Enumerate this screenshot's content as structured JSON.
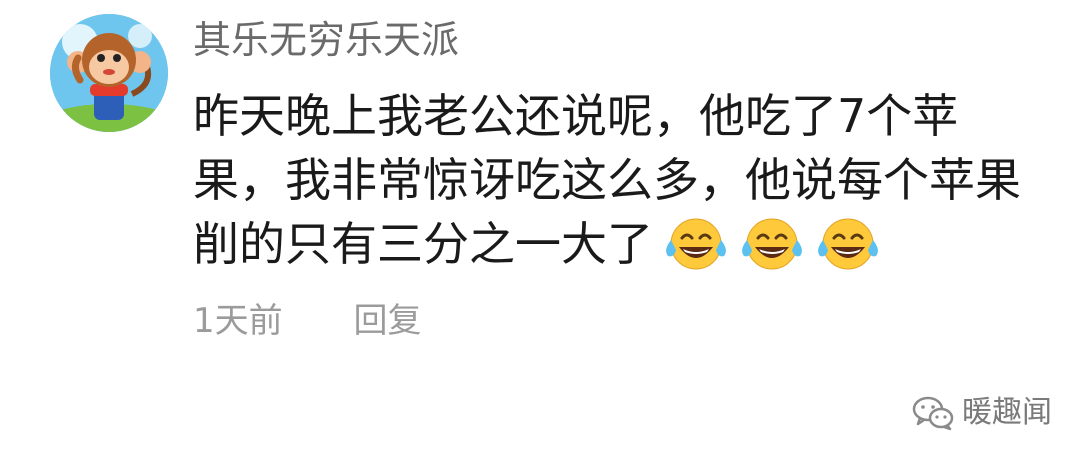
{
  "comment": {
    "username": "其乐无穷乐天派",
    "lines": [
      "昨天晚上我老公还说呢，他吃了7个苹",
      "果，我非常惊讶吃这么多，他说每个苹果",
      "削的只有三分之一大了"
    ],
    "emoji": [
      "tears-of-joy-icon",
      "tears-of-joy-icon",
      "tears-of-joy-icon"
    ],
    "time": "1天前",
    "reply_label": "回复"
  },
  "watermark": {
    "text": "暖趣闻",
    "icon": "wechat-icon"
  },
  "colors": {
    "username": "#6a6a6a",
    "body": "#1a1a1a",
    "meta": "#9b9b9b",
    "avatar_bg": "#6ec5ee",
    "emoji_face": "#ffc93c"
  }
}
